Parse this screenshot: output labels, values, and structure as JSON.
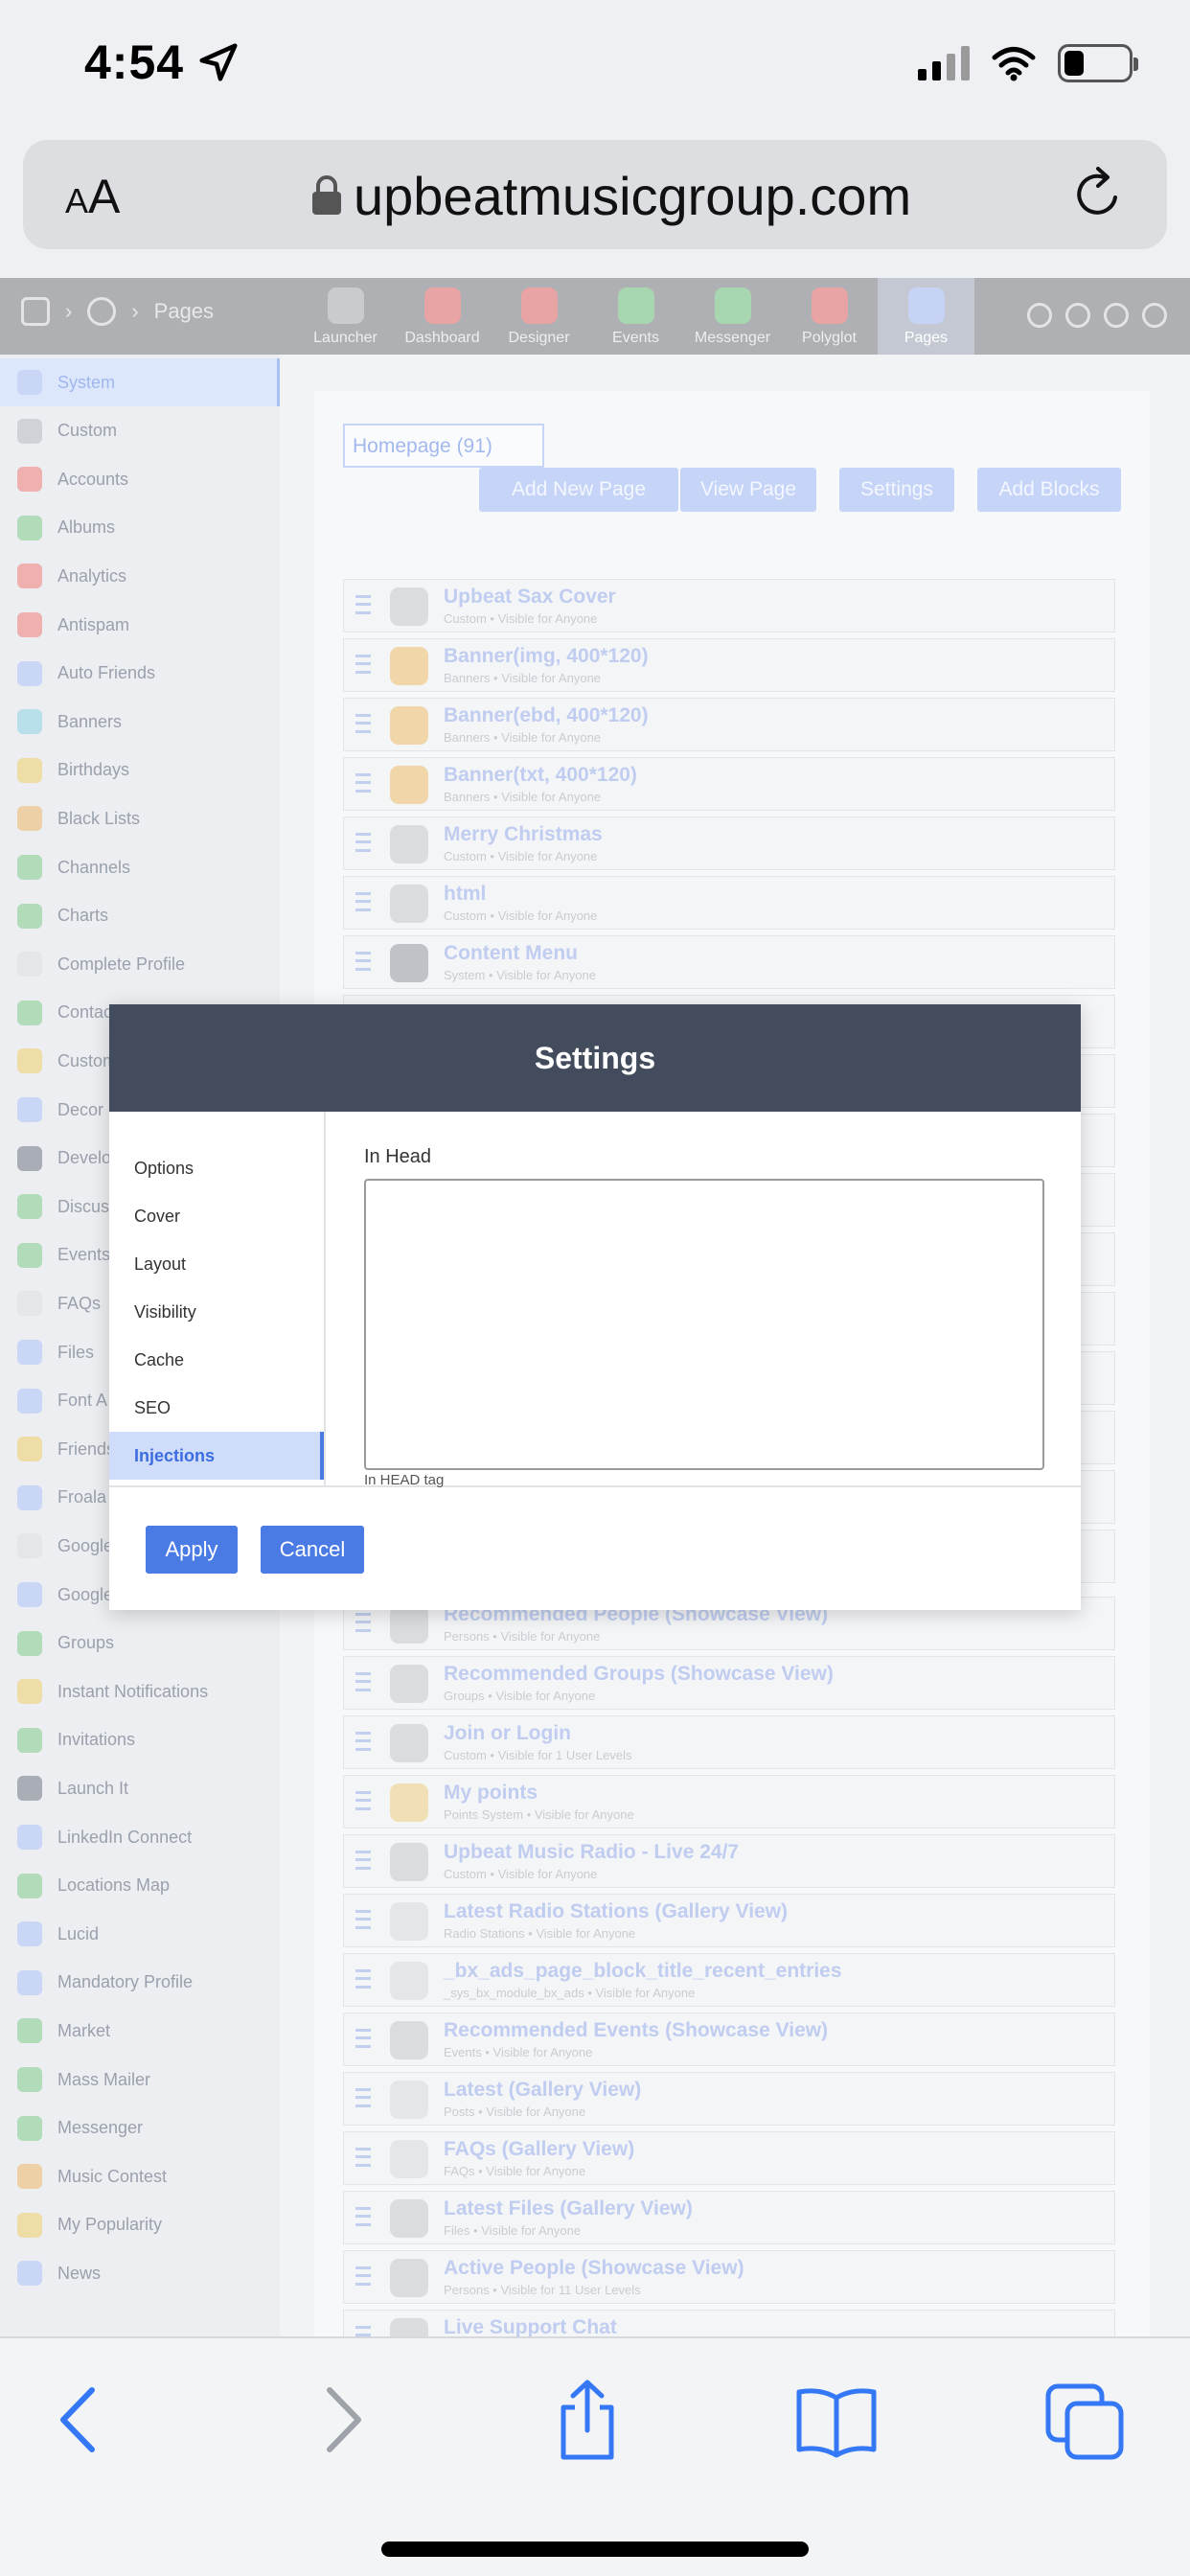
{
  "status": {
    "time": "4:54"
  },
  "browser": {
    "text_size_label_small": "A",
    "text_size_label_large": "A",
    "url": "upbeatmusicgroup.com"
  },
  "breadcrumb": {
    "current": "Pages"
  },
  "nav_apps": [
    {
      "label": "Launcher",
      "color": "#c9cbce"
    },
    {
      "label": "Dashboard",
      "color": "#e8a4a4"
    },
    {
      "label": "Designer",
      "color": "#e8a4a4"
    },
    {
      "label": "Events",
      "color": "#a8d6b0"
    },
    {
      "label": "Messenger",
      "color": "#a8d6b0"
    },
    {
      "label": "Polyglot",
      "color": "#e8a4a4"
    },
    {
      "label": "Pages",
      "color": "#c6d3f5"
    }
  ],
  "sidebar": {
    "items": [
      {
        "label": "System",
        "color": "#c9d6f5"
      },
      {
        "label": "Custom",
        "color": "#cfd2d6"
      },
      {
        "label": "Accounts",
        "color": "#efb0b0"
      },
      {
        "label": "Albums",
        "color": "#b2dcb9"
      },
      {
        "label": "Analytics",
        "color": "#efb0b0"
      },
      {
        "label": "Antispam",
        "color": "#efb0b0"
      },
      {
        "label": "Auto Friends",
        "color": "#c9d6f5"
      },
      {
        "label": "Banners",
        "color": "#b9e0ea"
      },
      {
        "label": "Birthdays",
        "color": "#eedda6"
      },
      {
        "label": "Black Lists",
        "color": "#eed0a6"
      },
      {
        "label": "Channels",
        "color": "#b2dcb9"
      },
      {
        "label": "Charts",
        "color": "#b2dcb9"
      },
      {
        "label": "Complete Profile",
        "color": "#e4e6e9"
      },
      {
        "label": "Contact",
        "color": "#b2dcb9"
      },
      {
        "label": "Custom",
        "color": "#eedda6"
      },
      {
        "label": "Decor",
        "color": "#c9d6f5"
      },
      {
        "label": "Developer",
        "color": "#a9aeb6"
      },
      {
        "label": "Discuss",
        "color": "#b2dcb9"
      },
      {
        "label": "Events",
        "color": "#b2dcb9"
      },
      {
        "label": "FAQs",
        "color": "#e4e6e9"
      },
      {
        "label": "Files",
        "color": "#c9d6f5"
      },
      {
        "label": "Font A",
        "color": "#c9d6f5"
      },
      {
        "label": "Friends",
        "color": "#eedda6"
      },
      {
        "label": "Froala",
        "color": "#c9d6f5"
      },
      {
        "label": "Google",
        "color": "#e4e6e9"
      },
      {
        "label": "Google Tag Manager",
        "color": "#c9d6f5"
      },
      {
        "label": "Groups",
        "color": "#b2dcb9"
      },
      {
        "label": "Instant Notifications",
        "color": "#eedda6"
      },
      {
        "label": "Invitations",
        "color": "#b2dcb9"
      },
      {
        "label": "Launch It",
        "color": "#a9aeb6"
      },
      {
        "label": "LinkedIn Connect",
        "color": "#c9d6f5"
      },
      {
        "label": "Locations Map",
        "color": "#b2dcb9"
      },
      {
        "label": "Lucid",
        "color": "#c9d6f5"
      },
      {
        "label": "Mandatory Profile",
        "color": "#c9d6f5"
      },
      {
        "label": "Market",
        "color": "#b2dcb9"
      },
      {
        "label": "Mass Mailer",
        "color": "#b2dcb9"
      },
      {
        "label": "Messenger",
        "color": "#b2dcb9"
      },
      {
        "label": "Music Contest",
        "color": "#eed0a6"
      },
      {
        "label": "My Popularity",
        "color": "#eedda6"
      },
      {
        "label": "News",
        "color": "#c9d6f5"
      }
    ]
  },
  "content": {
    "page_select": "Homepage (91)",
    "buttons": {
      "add_new_page": "Add New Page",
      "view_page": "View Page",
      "settings": "Settings",
      "add_blocks": "Add Blocks"
    },
    "blocks": [
      {
        "title": "Upbeat Sax Cover",
        "sub": "Custom • Visible for Anyone"
      },
      {
        "title": "Banner(img, 400*120)",
        "sub": "Banners • Visible for Anyone"
      },
      {
        "title": "Banner(ebd, 400*120)",
        "sub": "Banners • Visible for Anyone"
      },
      {
        "title": "Banner(txt, 400*120)",
        "sub": "Banners • Visible for Anyone"
      },
      {
        "title": "Merry Christmas",
        "sub": "Custom • Visible for Anyone"
      },
      {
        "title": "html",
        "sub": "Custom • Visible for Anyone"
      },
      {
        "title": "Content Menu",
        "sub": "System • Visible for Anyone"
      },
      {
        "title": "Recommended People (Showcase View)",
        "sub": "Persons • Visible for Anyone"
      },
      {
        "title": "Recommended Groups (Showcase View)",
        "sub": "Groups • Visible for Anyone"
      },
      {
        "title": "Join or Login",
        "sub": "Custom • Visible for 1 User Levels"
      },
      {
        "title": "My points",
        "sub": "Points System • Visible for Anyone"
      },
      {
        "title": "Upbeat Music Radio - Live 24/7",
        "sub": "Custom • Visible for Anyone"
      },
      {
        "title": "Latest Radio Stations (Gallery View)",
        "sub": "Radio Stations • Visible for Anyone"
      },
      {
        "title": "_bx_ads_page_block_title_recent_entries",
        "sub": "_sys_bx_module_bx_ads • Visible for Anyone"
      },
      {
        "title": "Recommended Events (Showcase View)",
        "sub": "Events • Visible for Anyone"
      },
      {
        "title": "Latest (Gallery View)",
        "sub": "Posts • Visible for Anyone"
      },
      {
        "title": "FAQs (Gallery View)",
        "sub": "FAQs • Visible for Anyone"
      },
      {
        "title": "Latest Files (Gallery View)",
        "sub": "Files • Visible for Anyone"
      },
      {
        "title": "Active People (Showcase View)",
        "sub": "Persons • Visible for 11 User Levels"
      },
      {
        "title": "Live Support Chat",
        "sub": ""
      }
    ]
  },
  "modal": {
    "title": "Settings",
    "tabs": [
      "Options",
      "Cover",
      "Layout",
      "Visibility",
      "Cache",
      "SEO",
      "Injections"
    ],
    "active_tab": "Injections",
    "field_label": "In Head",
    "field_value": "",
    "field_hint": "In HEAD tag",
    "apply_label": "Apply",
    "cancel_label": "Cancel"
  }
}
